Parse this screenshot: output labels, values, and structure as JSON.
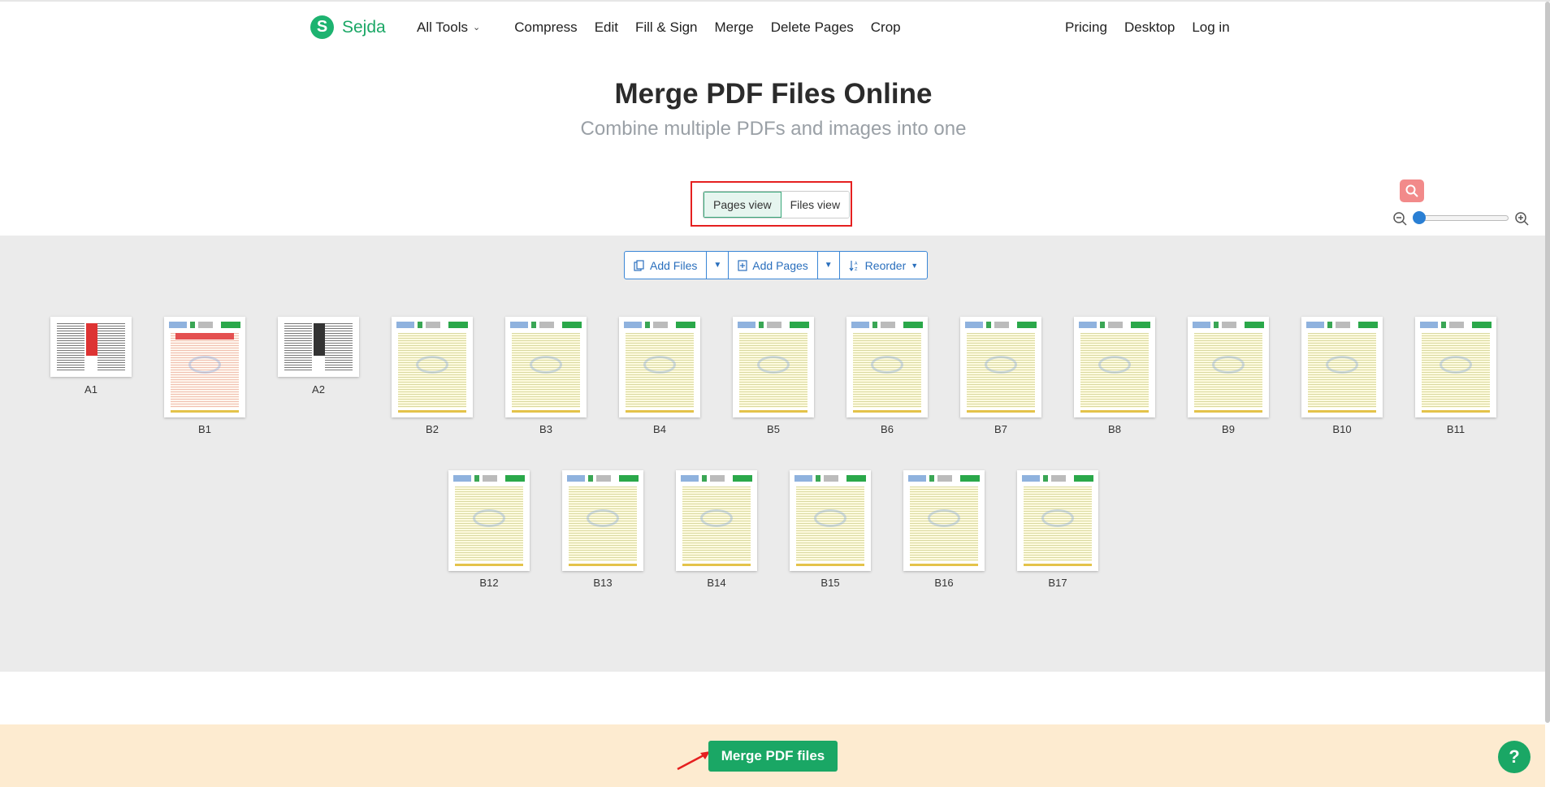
{
  "brand": {
    "logo_letter": "S",
    "name": "Sejda",
    "color": "#1aa765"
  },
  "nav": {
    "all_tools": "All Tools",
    "links": [
      "Compress",
      "Edit",
      "Fill & Sign",
      "Merge",
      "Delete Pages",
      "Crop"
    ],
    "right": [
      "Pricing",
      "Desktop",
      "Log in"
    ]
  },
  "hero": {
    "title": "Merge PDF Files Online",
    "subtitle": "Combine multiple PDFs and images into one"
  },
  "view_toggle": {
    "pages_view": "Pages view",
    "files_view": "Files view",
    "selected": "Pages view"
  },
  "toolbar": {
    "add_files": "Add Files",
    "add_pages": "Add Pages",
    "reorder": "Reorder"
  },
  "zoom": {
    "level": 0.0,
    "icons": [
      "search-icon",
      "zoom-out-icon",
      "zoom-in-icon"
    ]
  },
  "pages": [
    "A1",
    "B1",
    "A2",
    "B2",
    "B3",
    "B4",
    "B5",
    "B6",
    "B7",
    "B8",
    "B9",
    "B10",
    "B11",
    "B12",
    "B13",
    "B14",
    "B15",
    "B16",
    "B17"
  ],
  "footer": {
    "merge_button": "Merge PDF files",
    "help": "?"
  }
}
